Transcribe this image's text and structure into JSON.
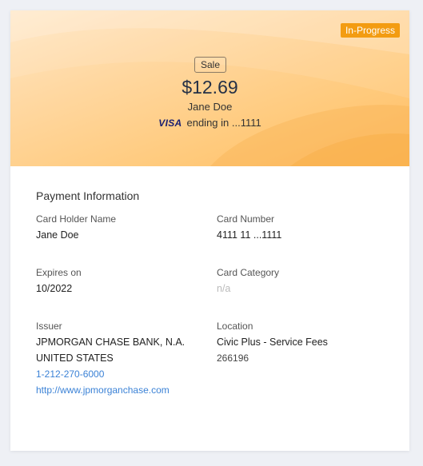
{
  "hero": {
    "status_badge": "In-Progress",
    "transaction_type": "Sale",
    "amount": "$12.69",
    "card_holder": "Jane Doe",
    "card_brand": "VISA",
    "card_ending": "ending in ...1111",
    "colors": {
      "status": "#f39c12",
      "hero_start": "#ffe6c4",
      "hero_end": "#ffbd62"
    }
  },
  "payment_info": {
    "title": "Payment Information",
    "card_holder_label": "Card Holder Name",
    "card_holder_value": "Jane Doe",
    "card_number_label": "Card Number",
    "card_number_value": "4111 11 ...1111",
    "expires_label": "Expires on",
    "expires_value": "10/2022",
    "category_label": "Card Category",
    "category_value": "n/a",
    "issuer_label": "Issuer",
    "issuer_name": "JPMORGAN CHASE BANK, N.A.",
    "issuer_country": "UNITED STATES",
    "issuer_phone": "1-212-270-6000",
    "issuer_url": "http://www.jpmorganchase.com",
    "location_label": "Location",
    "location_name": "Civic Plus - Service Fees",
    "location_id": "266196"
  }
}
